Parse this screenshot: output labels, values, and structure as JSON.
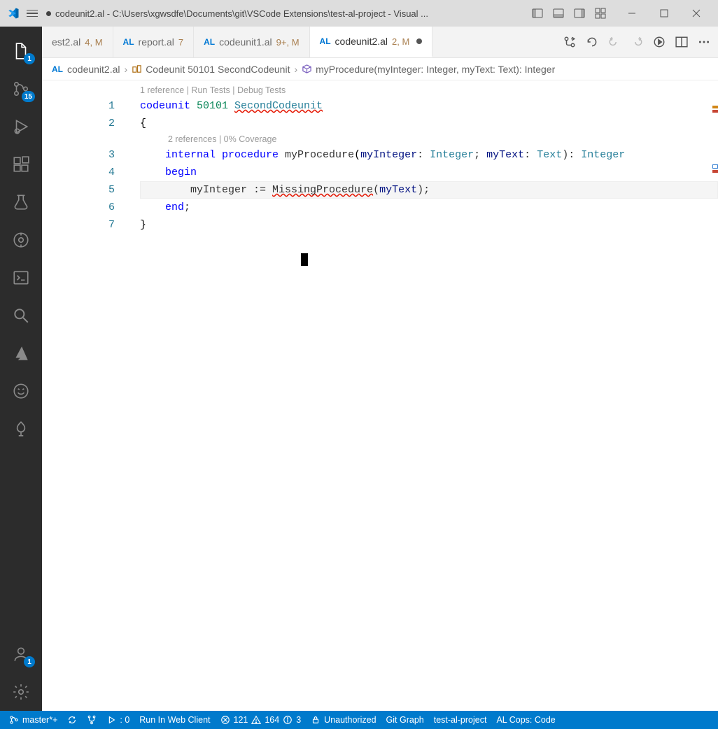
{
  "title": "codeunit2.al - C:\\Users\\xgwsdfe\\Documents\\git\\VSCode Extensions\\test-al-project - Visual ...",
  "activitybar": {
    "explorer_badge": "1",
    "scm_badge": "15",
    "account_badge": "1"
  },
  "tabs": [
    {
      "al": "",
      "name": "est2.al",
      "counts": "4, M"
    },
    {
      "al": "AL",
      "name": "report.al",
      "counts": "7"
    },
    {
      "al": "AL",
      "name": "codeunit1.al",
      "counts": "9+, M"
    },
    {
      "al": "AL",
      "name": "codeunit2.al",
      "counts": "2, M",
      "active": true,
      "dirty": true
    }
  ],
  "breadcrumbs": {
    "al": "AL",
    "file": "codeunit2.al",
    "symbol1": "Codeunit 50101 SecondCodeunit",
    "symbol2": "myProcedure(myInteger: Integer, myText: Text): Integer"
  },
  "codelens": {
    "top": "1 reference | Run Tests | Debug Tests",
    "proc": "2 references | 0% Coverage"
  },
  "lines": [
    "1",
    "2",
    "3",
    "4",
    "5",
    "6",
    "7"
  ],
  "code": {
    "l1_kw": "codeunit",
    "l1_num": " 50101 ",
    "l1_name": "SecondCodeunit",
    "l2": "{",
    "l3_int": "    internal",
    "l3_proc": " procedure",
    "l3_name": " myProcedure",
    "l3_p1": "(",
    "l3_a1": "myInteger",
    "l3_c1": ": ",
    "l3_t1": "Integer",
    "l3_sc": "; ",
    "l3_a2": "myText",
    "l3_c2": ": ",
    "l3_t2": "Text",
    "l3_p2": "): ",
    "l3_ret": "Integer",
    "l4": "    begin",
    "l5_pre": "        myInteger := ",
    "l5_call": "MissingProcedure",
    "l5_p1": "(",
    "l5_arg": "myText",
    "l5_p2": ");",
    "l6": "    end",
    "l6_sc": ";",
    "l7": "}"
  },
  "status": {
    "branch": "master*+",
    "diag_count": ": 0",
    "run": "Run In Web Client",
    "err": "121",
    "warn": "164",
    "info": "3",
    "auth": "Unauthorized",
    "gitgraph": "Git Graph",
    "project": "test-al-project",
    "cops": "AL Cops: Code"
  }
}
